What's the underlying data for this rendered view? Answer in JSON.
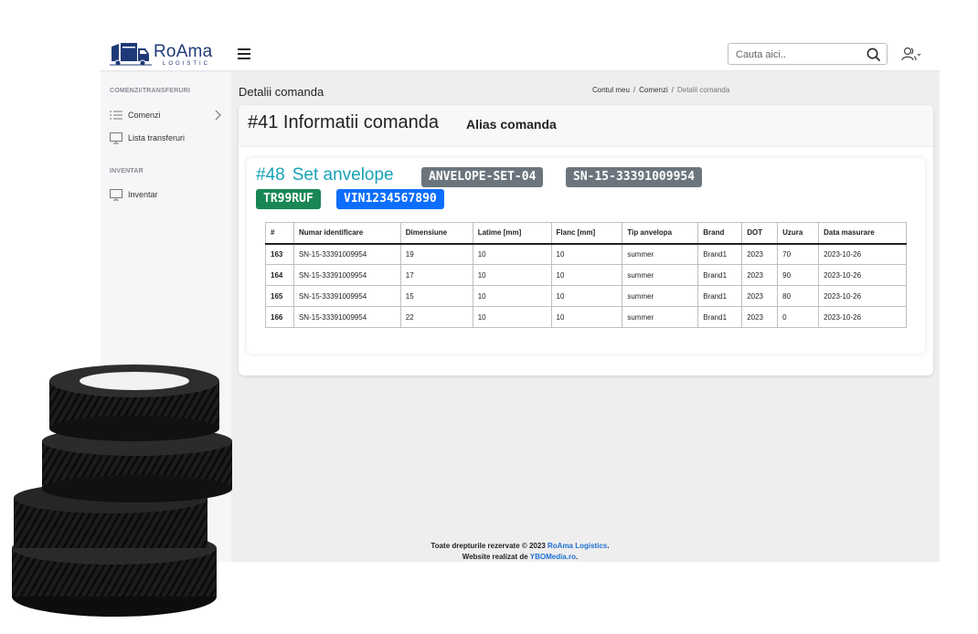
{
  "brand": {
    "name": "RoAma",
    "sub": "LOGISTIC",
    "color": "#1f3a78"
  },
  "topbar": {
    "search_placeholder": "Cauta aici..",
    "menu_icon": "hamburger-icon",
    "user_icon": "user-icon"
  },
  "sidebar": {
    "section1": "COMENZI/TRANSFERURI",
    "items1": [
      {
        "label": "Comenzi",
        "icon": "list-icon"
      },
      {
        "label": "Lista transferuri",
        "icon": "monitor-icon"
      }
    ],
    "section2": "INVENTAR",
    "items2": [
      {
        "label": "Inventar",
        "icon": "monitor-icon"
      }
    ]
  },
  "page": {
    "title": "Detalii comanda",
    "breadcrumb": [
      "Contul meu",
      "Comenzi",
      "Detalii comanda"
    ]
  },
  "order": {
    "title": "#41 Informatii comanda",
    "alias": "Alias comanda"
  },
  "set": {
    "number": "#48",
    "name": "Set anvelope",
    "badges": [
      {
        "text": "ANVELOPE-SET-04",
        "color": "#6c757d"
      },
      {
        "text": "SN-15-33391009954",
        "color": "#6c757d"
      },
      {
        "text": "TR99RUF",
        "color": "#198754"
      },
      {
        "text": "VIN1234567890",
        "color": "#0d6efd"
      }
    ]
  },
  "table": {
    "headers": [
      "#",
      "Numar identificare",
      "Dimensiune",
      "Latime [mm]",
      "Flanc [mm]",
      "Tip anvelopa",
      "Brand",
      "DOT",
      "Uzura",
      "Data masurare"
    ],
    "rows": [
      [
        "163",
        "SN-15-33391009954",
        "19",
        "10",
        "10",
        "summer",
        "Brand1",
        "2023",
        "70",
        "2023-10-26"
      ],
      [
        "164",
        "SN-15-33391009954",
        "17",
        "10",
        "10",
        "summer",
        "Brand1",
        "2023",
        "90",
        "2023-10-26"
      ],
      [
        "165",
        "SN-15-33391009954",
        "15",
        "10",
        "10",
        "summer",
        "Brand1",
        "2023",
        "80",
        "2023-10-26"
      ],
      [
        "166",
        "SN-15-33391009954",
        "22",
        "10",
        "10",
        "summer",
        "Brand1",
        "2023",
        "0",
        "2023-10-26"
      ]
    ]
  },
  "footer": {
    "line1_prefix": "Toate drepturile rezervate © 2023 ",
    "line1_link": "RoAma Logistics",
    "line1_suffix": ".",
    "line2_prefix": "Website realizat de ",
    "line2_link": "YBOMedia.ro",
    "line2_suffix": "."
  }
}
